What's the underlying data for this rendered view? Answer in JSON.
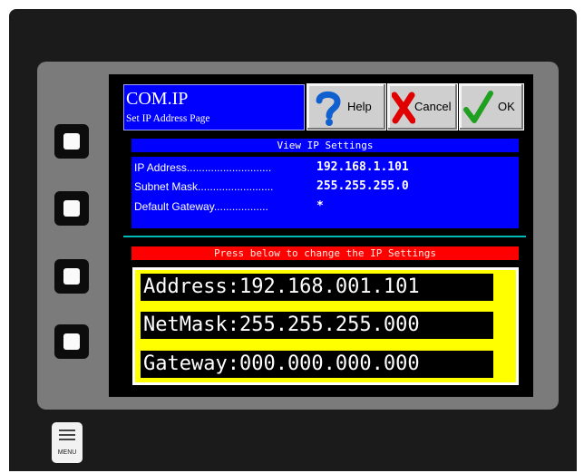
{
  "header": {
    "title": "COM.IP",
    "subtitle": "Set IP Address Page"
  },
  "toolbar": {
    "help_label": "Help",
    "cancel_label": "Cancel",
    "ok_label": "OK"
  },
  "view_bar": "View IP Settings",
  "info": {
    "ip_label": "IP Address............................",
    "ip_value": "192.168.1.101",
    "mask_label": "Subnet Mask.........................",
    "mask_value": "255.255.255.0",
    "gateway_label": "Default Gateway..................",
    "gateway_value": "*"
  },
  "press_bar": "Press below to change the IP Settings",
  "edit": {
    "address": "Address:192.168.001.101",
    "netmask": "NetMask:255.255.255.000",
    "gateway": "Gateway:000.000.000.000"
  },
  "menu_label": "MENU",
  "icons": {
    "help": "question-mark-icon",
    "cancel": "red-x-icon",
    "ok": "green-check-icon",
    "menu": "menu-icon"
  },
  "colors": {
    "screen_blue": "#0000ff",
    "press_red": "#ff0000",
    "edit_yellow": "#ffff00",
    "separator_teal": "#00b8b8"
  }
}
